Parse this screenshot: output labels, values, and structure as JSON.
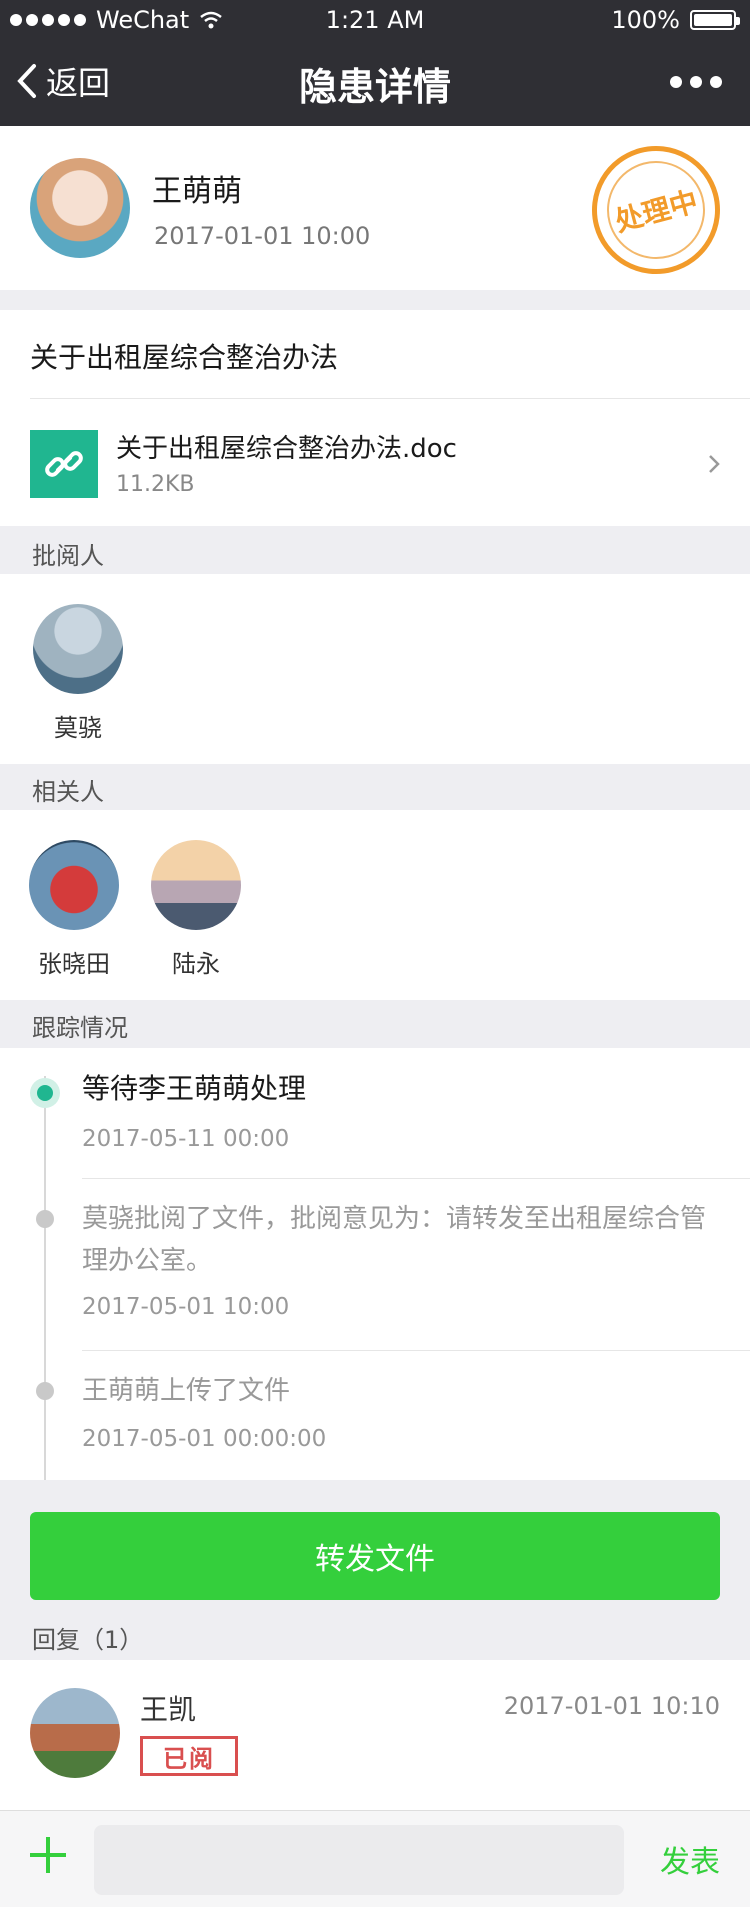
{
  "status": {
    "carrier": "WeChat",
    "time": "1:21 AM",
    "battery": "100%"
  },
  "nav": {
    "back_label": "返回",
    "title": "隐患详情"
  },
  "header": {
    "author": "王萌萌",
    "time": "2017-01-01 10:00",
    "stamp": "处理中",
    "stamp_color": "#f29b2a"
  },
  "doc": {
    "title": "关于出租屋综合整治办法",
    "file_name": "关于出租屋综合整治办法.doc",
    "file_size": "11.2KB"
  },
  "reviewers": {
    "label": "批阅人",
    "people": [
      {
        "name": "莫骁"
      }
    ]
  },
  "related": {
    "label": "相关人",
    "people": [
      {
        "name": "张晓田"
      },
      {
        "name": "陆永"
      }
    ]
  },
  "tracking": {
    "label": "跟踪情况",
    "items": [
      {
        "text": "等待李王萌萌处理",
        "time": "2017-05-11 00:00"
      },
      {
        "text": "莫骁批阅了文件，批阅意见为：请转发至出租屋综合管理办公室。",
        "time": "2017-05-01 10:00"
      },
      {
        "text": "王萌萌上传了文件",
        "time": "2017-05-01 00:00:00"
      }
    ]
  },
  "forward_button": "转发文件",
  "replies": {
    "label": "回复（1）",
    "items": [
      {
        "name": "王凯",
        "time": "2017-01-01 10:10",
        "badge": "已阅"
      }
    ]
  },
  "bottom": {
    "send_label": "发表"
  },
  "colors": {
    "accent_green": "#34cf3c",
    "teal": "#20b690",
    "nav_bg": "#2f2f34",
    "badge_red": "#d94f4f"
  }
}
